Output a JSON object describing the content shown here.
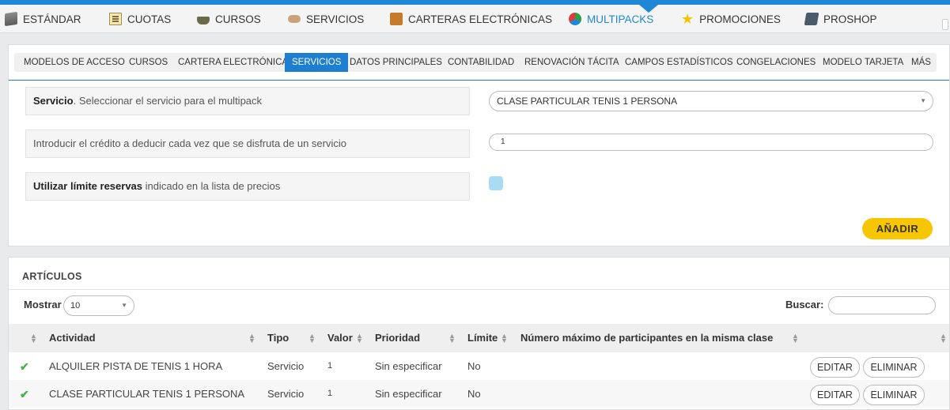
{
  "top_tabs": [
    {
      "label": "ESTÁNDAR",
      "icon": "box-icon"
    },
    {
      "label": "CUOTAS",
      "icon": "document-icon"
    },
    {
      "label": "CURSOS",
      "icon": "graduation-cap-icon"
    },
    {
      "label": "SERVICIOS",
      "icon": "handshake-icon"
    },
    {
      "label": "CARTERAS ELECTRÓNICAS",
      "icon": "wallet-icon"
    },
    {
      "label": "MULTIPACKS",
      "icon": "multipack-icon",
      "active": true
    },
    {
      "label": "PROMOCIONES",
      "icon": "star-icon"
    },
    {
      "label": "PROSHOP",
      "icon": "cash-register-icon"
    }
  ],
  "sub_tabs": [
    {
      "label": "MODELOS DE ACCESO"
    },
    {
      "label": "CURSOS"
    },
    {
      "label": "CARTERA ELECTRÓNICA"
    },
    {
      "label": "SERVICIOS",
      "active": true
    },
    {
      "label": "DATOS PRINCIPALES"
    },
    {
      "label": "CONTABILIDAD"
    },
    {
      "label": "RENOVACIÓN TÁCITA"
    },
    {
      "label": "CAMPOS ESTADÍSTICOS"
    },
    {
      "label": "CONGELACIONES"
    },
    {
      "label": "MODELO TARJETA"
    },
    {
      "label": "MÁS"
    }
  ],
  "form": {
    "servicio_bold": "Servicio",
    "servicio_rest": ". Seleccionar el servicio para el multipack",
    "servicio_value": "CLASE PARTICULAR TENIS 1 PERSONA",
    "credito_label": "Introducir el crédito a deducir cada vez que se disfruta de un servicio",
    "credito_value": "1",
    "limite_bold": "Utilizar límite reservas",
    "limite_rest": " indicado en la lista de precios",
    "add_button": "AÑADIR"
  },
  "articulos": {
    "title": "ARTÍCULOS",
    "mostrar_label": "Mostrar",
    "mostrar_value": "10",
    "buscar_label": "Buscar:",
    "columns": [
      "Actividad",
      "Tipo",
      "Valor",
      "Prioridad",
      "Límite",
      "Número máximo de participantes en la misma clase"
    ],
    "rows": [
      {
        "actividad": "ALQUILER PISTA DE TENIS 1 HORA",
        "tipo": "Servicio",
        "valor": "1",
        "prioridad": "Sin especificar",
        "limite": "No"
      },
      {
        "actividad": "CLASE PARTICULAR TENIS 1 PERSONA",
        "tipo": "Servicio",
        "valor": "1",
        "prioridad": "Sin especificar",
        "limite": "No"
      }
    ],
    "edit_label": "EDITAR",
    "delete_label": "ELIMINAR"
  },
  "colors": {
    "accent": "#1e88d6",
    "add_button": "#f7c600",
    "check": "#4caf50"
  }
}
